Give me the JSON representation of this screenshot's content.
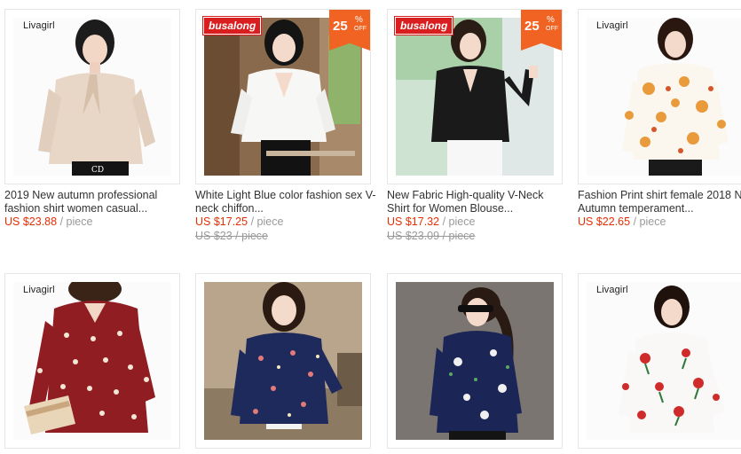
{
  "products": [
    {
      "brand_text": "Livagirl",
      "title": "2019 New autumn professional fashion shirt women casual...",
      "price": "US $23.88",
      "unit": "/ piece",
      "image_description": "woman in beige blouse with bow"
    },
    {
      "brand_badge": "busalong",
      "discount": "25",
      "discount_pct": "%",
      "discount_off": "OFF",
      "title": "White Light Blue color fashion sex V-neck chiffon...",
      "price": "US $17.25",
      "unit": "/ piece",
      "old_price": "US $23 / piece"
    },
    {
      "brand_badge": "busalong",
      "discount": "25",
      "discount_pct": "%",
      "discount_off": "OFF",
      "title": "New Fabric High-quality V-Neck Shirt for Women Blouse...",
      "price": "US $17.32",
      "unit": "/ piece",
      "old_price": "US $23.09 / piece"
    },
    {
      "brand_text": "Livagirl",
      "title": "Fashion Print shirt female 2018 New Autumn temperament...",
      "price": "US $22.65",
      "unit": "/ piece"
    },
    {
      "brand_text": "Livagirl"
    },
    {},
    {},
    {
      "brand_text": "Livagirl"
    }
  ],
  "colors": {
    "price": "#e62e04",
    "discount": "#f06322",
    "badge": "#d81e1e",
    "muted": "#999999"
  }
}
